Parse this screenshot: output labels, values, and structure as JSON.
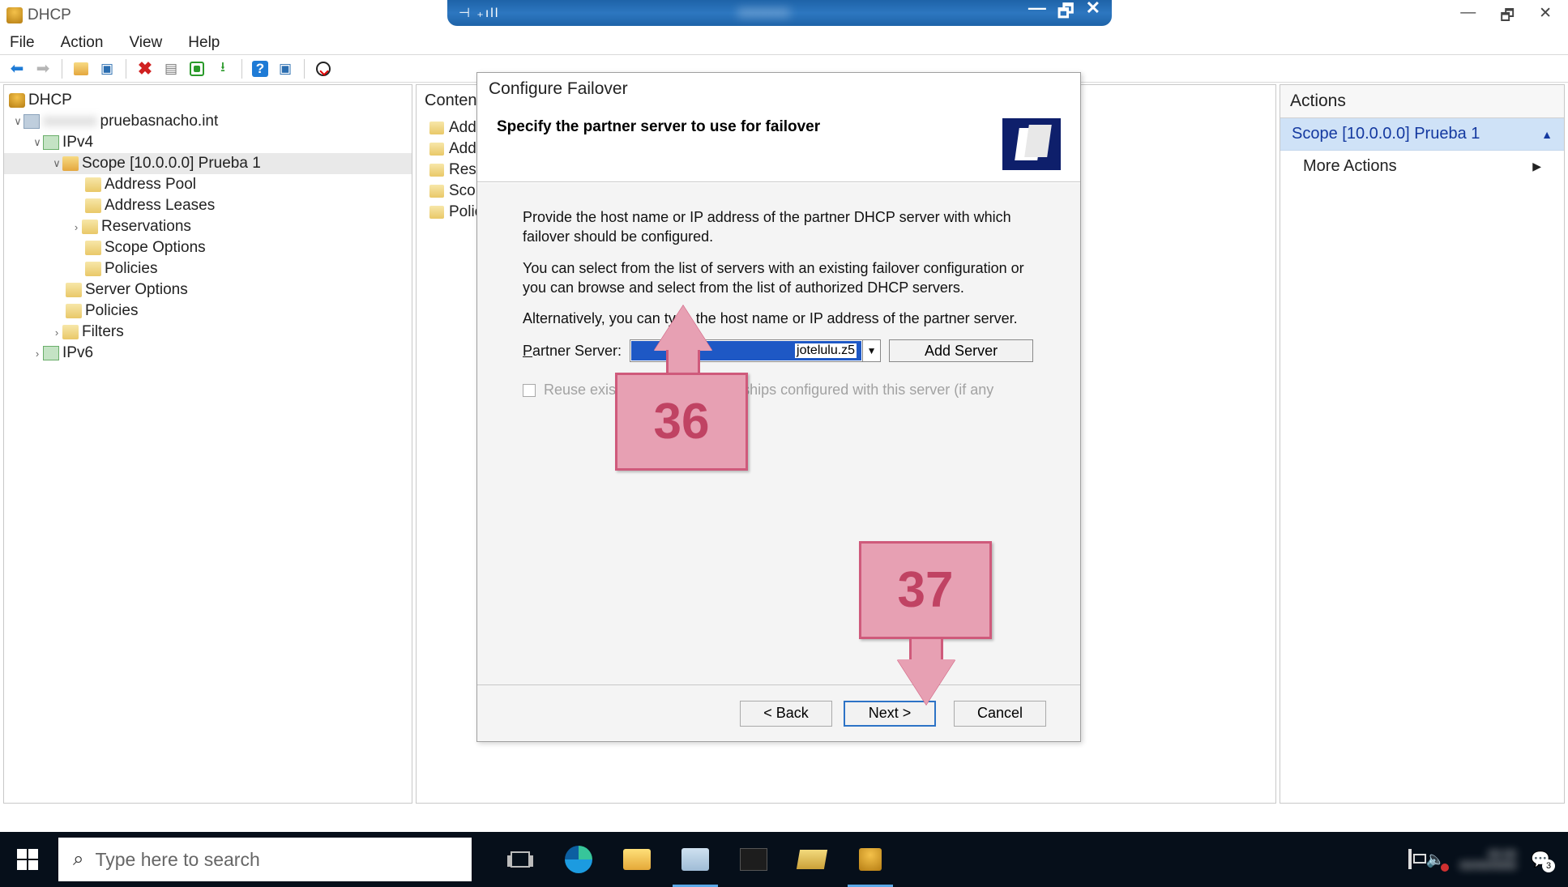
{
  "outer_window": {
    "minimize": "—",
    "restore": "🗗",
    "close": "✕"
  },
  "vm_bar": {
    "signal": "⊣ ₊ıll",
    "min": "—",
    "restore": "🗗",
    "close": "✕"
  },
  "app_title": "DHCP",
  "menu": {
    "file": "File",
    "action": "Action",
    "view": "View",
    "help": "Help"
  },
  "tree": {
    "root": "DHCP",
    "server_suffix": "pruebasnacho.int",
    "ipv4": "IPv4",
    "scope": "Scope [10.0.0.0] Prueba 1",
    "address_pool": "Address Pool",
    "address_leases": "Address Leases",
    "reservations": "Reservations",
    "scope_options": "Scope Options",
    "policies": "Policies",
    "server_options": "Server Options",
    "server_policies": "Policies",
    "filters": "Filters",
    "ipv6": "IPv6"
  },
  "contents": {
    "header": "Content",
    "items": [
      "Addr",
      "Addr",
      "Rese",
      "Scop",
      "Polic"
    ]
  },
  "actions": {
    "title": "Actions",
    "scope": "Scope [10.0.0.0] Prueba 1",
    "more": "More Actions"
  },
  "wizard": {
    "title": "Configure Failover",
    "heading": "Specify the partner server to use for failover",
    "p1": "Provide the host name or IP address of the partner DHCP server with which failover should be configured.",
    "p2": "You can select from the list of servers with an existing failover configuration or you can browse and select from the list of authorized DHCP servers.",
    "p3": "Alternatively, you can type the host name or IP address of the partner server.",
    "partner_label": "Partner Server:",
    "partner_value": "jotelulu.z5",
    "add_server": "Add Server",
    "reuse": "Reuse existing failover relationships configured with this server (if any",
    "back": "< Back",
    "next": "Next >",
    "cancel": "Cancel"
  },
  "callouts": {
    "a": "36",
    "b": "37"
  },
  "taskbar": {
    "search_placeholder": "Type here to search",
    "notif_count": "3"
  }
}
